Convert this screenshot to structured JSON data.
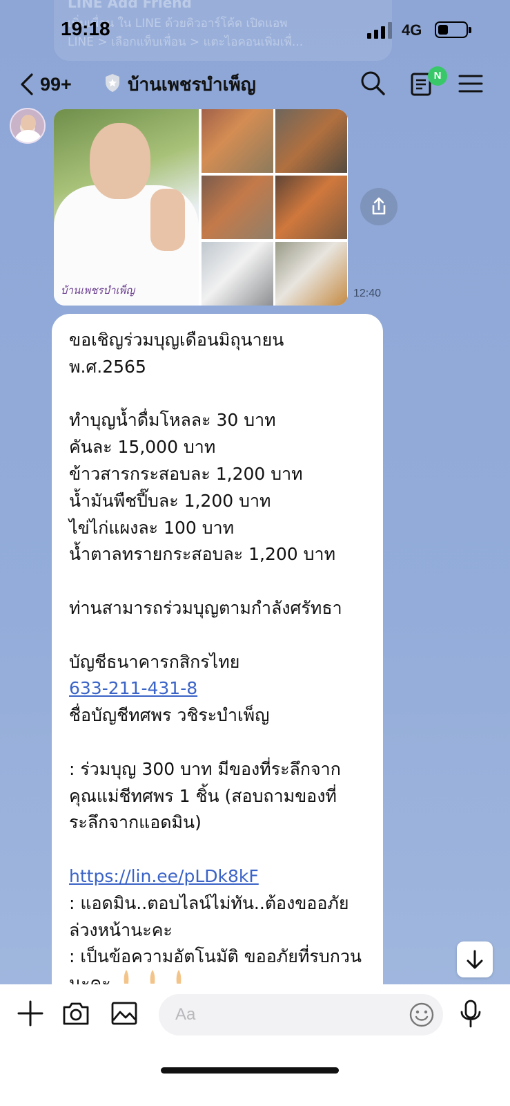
{
  "status_bar": {
    "time": "19:18",
    "network": "4G",
    "battery_level": 0.3,
    "background_banner": {
      "title": "LINE Add Friend",
      "line1": "เพิ่มเพื่อน ใน LINE ด้วยคิวอาร์โค้ด เปิดแอพ",
      "line2": "LINE > เลือกแท็บเพื่อน > แตะไอคอนเพิ่มเพื่..."
    }
  },
  "header": {
    "back_count": "99+",
    "title": "บ้านเพชรบำเพ็ญ",
    "notes_badge": "N"
  },
  "image_message": {
    "caption": "บ้านเพชรบำเพ็ญ",
    "time": "12:40"
  },
  "text_message": {
    "lines": [
      "ขอเชิญร่วมบุญเดือนมิถุนายน",
      "พ.ศ.2565",
      "",
      "ทำบุญน้ำดื่มโหลละ 30 บาท",
      "คันละ 15,000 บาท",
      "ข้าวสารกระสอบละ 1,200 บาท",
      "น้ำมันพืชปี๊บละ 1,200 บาท",
      "ไข่ไก่แผงละ 100 บาท",
      "น้ำตาลทรายกระสอบละ 1,200 บาท",
      "",
      "ท่านสามารถร่วมบุญตามกำลังศรัทธา",
      "",
      "บัญชีธนาคารกสิกรไทย",
      "633-211-431-8",
      "ชื่อบัญชีทศพร วชิระบำเพ็ญ",
      "",
      ": ร่วมบุญ 300 บาท มีของที่ระลึกจาก",
      "คุณแม่ชีทศพร 1 ชิ้น (สอบถามของที่",
      "ระลึกจากแอดมิน)",
      "",
      "https://lin.ee/pLDk8kF",
      ": แอดมิน..ตอบไลน์ไม่ทัน..ต้องขออภัย",
      "ล่วงหน้านะคะ",
      ": เป็นข้อความอัตโนมัติ ขออภัยที่รบกวน",
      "นะคะ"
    ]
  },
  "input": {
    "placeholder": "Aa"
  },
  "icons": {
    "back": "chevron-left-icon",
    "search": "search-icon",
    "notes": "notes-icon",
    "menu": "menu-icon",
    "share": "share-icon",
    "scroll_down": "arrow-down-icon",
    "add": "plus-icon",
    "camera": "camera-icon",
    "gallery": "image-icon",
    "emoji": "smiley-icon",
    "voice": "microphone-icon"
  },
  "colors": {
    "background": "#8ea6d6",
    "link": "#3a63c7",
    "badge": "#38c86a",
    "bubble": "#ffffff"
  }
}
